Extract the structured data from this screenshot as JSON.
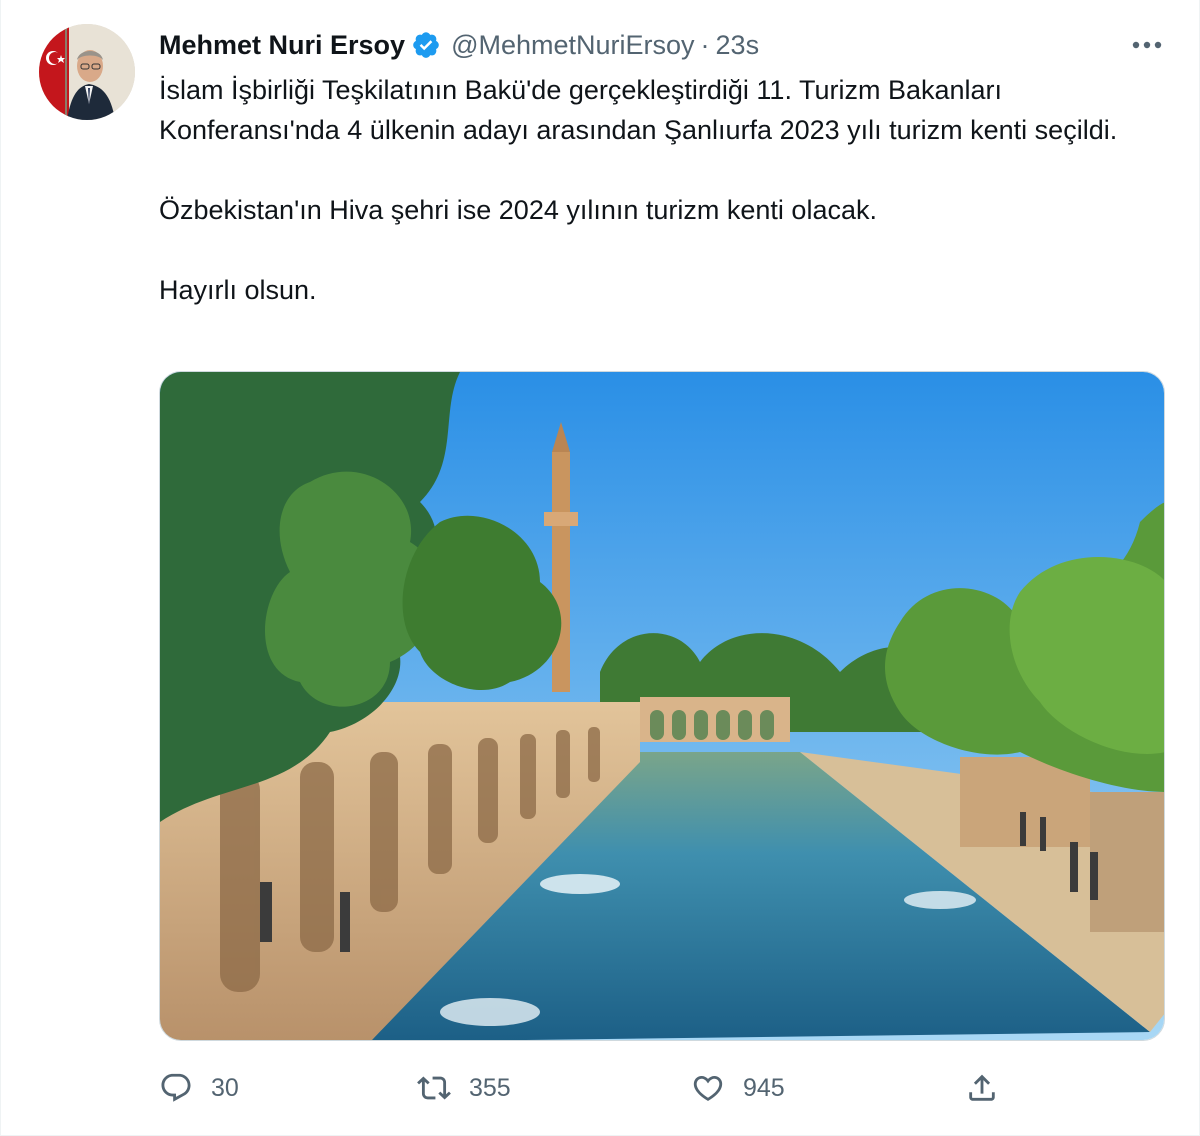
{
  "tweet": {
    "display_name": "Mehmet Nuri Ersoy",
    "verified": true,
    "handle": "@MehmetNuriErsoy",
    "separator": "·",
    "timestamp": "23s",
    "paragraphs": [
      "İslam İşbirliği Teşkilatının Bakü'de gerçekleştirdiği 11. Turizm Bakanları Konferansı'nda 4 ülkenin adayı arasından Şanlıurfa 2023 yılı turizm kenti seçildi.",
      "Özbekistan'ın Hiva şehri ise 2024 yılının turizm kenti olacak.",
      "Hayırlı olsun."
    ],
    "media": {
      "icon": "photo"
    }
  },
  "actions": {
    "reply_count": "30",
    "retweet_count": "355",
    "like_count": "945"
  },
  "icons": {
    "more": "more-icon",
    "reply": "reply-icon",
    "retweet": "retweet-icon",
    "like": "heart-icon",
    "share": "share-icon",
    "verified": "verified-badge-icon"
  },
  "colors": {
    "text": "#0f1419",
    "secondary": "#536471",
    "verified": "#1d9bf0",
    "border": "#eff3f4"
  }
}
